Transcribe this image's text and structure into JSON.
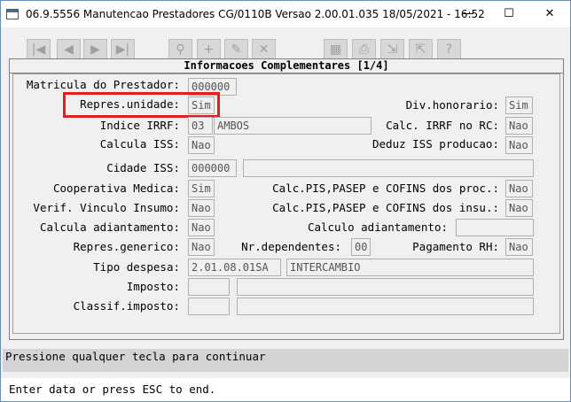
{
  "window": {
    "title": "06.9.5556 Manutencao  Prestadores CG/0110B Versao 2.00.01.035 18/05/2021 - 16:52",
    "minimize": "—",
    "maximize": "☐",
    "close": "✕"
  },
  "toolbar": {
    "icons": [
      "first-icon",
      "prev-icon",
      "next-icon",
      "last-icon",
      "search-icon",
      "add-icon",
      "edit-icon",
      "delete-icon",
      "print-icon",
      "copy-icon",
      "export-icon",
      "import-icon",
      "help-icon"
    ],
    "glyphs": [
      "|◀",
      "◀",
      "▶",
      "▶|",
      "⚲",
      "+",
      "✎",
      "✕",
      "▦",
      "⎙",
      "⇲",
      "⇱",
      "?"
    ]
  },
  "panel": {
    "title": "Informacoes Complementares [1/4]"
  },
  "fields": {
    "matricula_prestador": {
      "label": "Matricula do Prestador:",
      "value": "000000"
    },
    "repres_unidade": {
      "label": "Repres.unidade:",
      "value": "Sim"
    },
    "div_honorario": {
      "label": "Div.honorario:",
      "value": "Sim"
    },
    "indice_irrf": {
      "label": "Indice IRRF:",
      "code": "03",
      "desc": "AMBOS"
    },
    "calc_irrf_rc": {
      "label": "Calc. IRRF no RC:",
      "value": "Nao"
    },
    "calcula_iss": {
      "label": "Calcula ISS:",
      "value": "Nao"
    },
    "deduz_iss": {
      "label": "Deduz ISS producao:",
      "value": "Nao"
    },
    "cidade_iss": {
      "label": "Cidade ISS:",
      "code": "000000",
      "desc": ""
    },
    "cooperativa_medica": {
      "label": "Cooperativa Medica:",
      "value": "Sim"
    },
    "calc_pis_proc": {
      "label": "Calc.PIS,PASEP e COFINS dos proc.:",
      "value": "Nao"
    },
    "verif_vinculo": {
      "label": "Verif. Vinculo Insumo:",
      "value": "Nao"
    },
    "calc_pis_insu": {
      "label": "Calc.PIS,PASEP e COFINS dos insu.:",
      "value": "Nao"
    },
    "calcula_adiantamento": {
      "label": "Calcula adiantamento:",
      "value": "Nao"
    },
    "calculo_adiantamento": {
      "label": "Calculo adiantamento:",
      "value": ""
    },
    "repres_generico": {
      "label": "Repres.generico:",
      "value": "Nao"
    },
    "nr_dependentes": {
      "label": "Nr.dependentes:",
      "value": "00"
    },
    "pagamento_rh": {
      "label": "Pagamento RH:",
      "value": "Nao"
    },
    "tipo_despesa": {
      "label": "Tipo despesa:",
      "code": "2.01.08.01SA",
      "desc": "INTERCAMBIO"
    },
    "imposto": {
      "label": "Imposto:",
      "code": "",
      "desc": ""
    },
    "classif_imposto": {
      "label": "Classif.imposto:",
      "code": "",
      "desc": ""
    }
  },
  "status": {
    "message": "Pressione qualquer tecla para continuar",
    "prompt": "Enter data or press ESC to end."
  },
  "colors": {
    "highlight": "#e02020",
    "status_bg": "#d4d4d4"
  }
}
